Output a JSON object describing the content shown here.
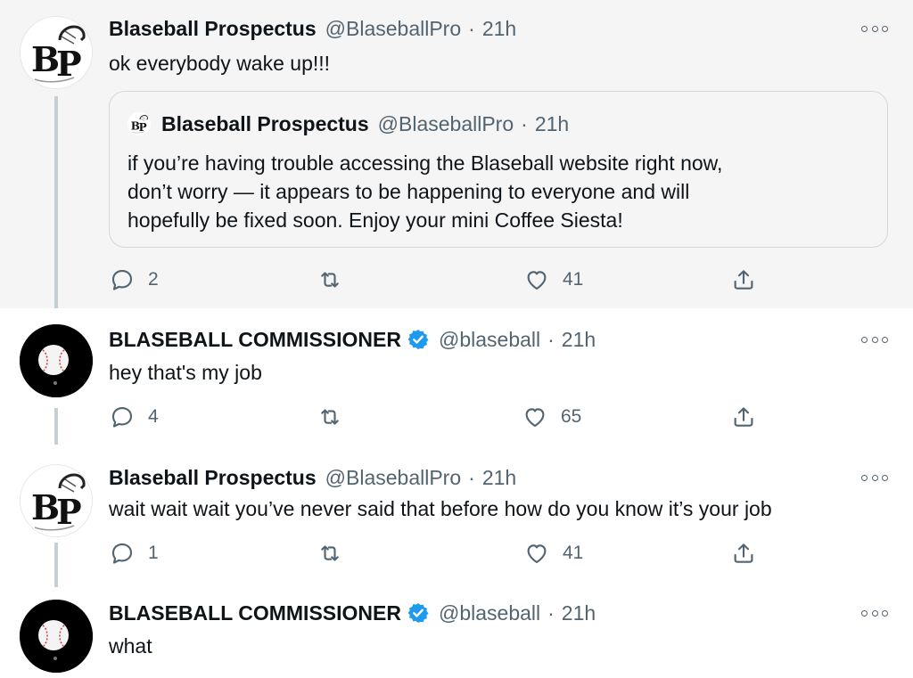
{
  "tweets": [
    {
      "author": "Blaseball Prospectus",
      "handle": "@BlaseballPro",
      "time": "21h",
      "text": "ok everybody wake up!!!",
      "quoted": {
        "author": "Blaseball Prospectus",
        "handle": "@BlaseballPro",
        "time": "21h",
        "lines": [
          "if you’re having trouble accessing the Blaseball website right now,",
          "don’t worry — it appears to be happening to everyone and will",
          "hopefully be fixed soon. Enjoy your mini Coffee Siesta!"
        ]
      },
      "replies": "2",
      "likes": "41"
    },
    {
      "author": "BLASEBALL COMMISSIONER",
      "handle": "@blaseball",
      "time": "21h",
      "text": "hey that's my job",
      "replies": "4",
      "likes": "65"
    },
    {
      "author": "Blaseball Prospectus",
      "handle": "@BlaseballPro",
      "time": "21h",
      "text": "wait wait wait you’ve never said that before how do you know it’s your job",
      "replies": "1",
      "likes": "41"
    },
    {
      "author": "BLASEBALL COMMISSIONER",
      "handle": "@blaseball",
      "time": "21h",
      "text": "what"
    }
  ],
  "avatar_text": "BP",
  "separator": "·",
  "icons": [
    "reply-icon",
    "retweet-icon",
    "like-icon",
    "share-icon",
    "more-icon",
    "verified-icon"
  ],
  "colors": {
    "verified": "#1d9bf0",
    "muted": "#536471",
    "highlight_bg": "#f5f5f5",
    "thread_line": "#c4cfd6"
  }
}
